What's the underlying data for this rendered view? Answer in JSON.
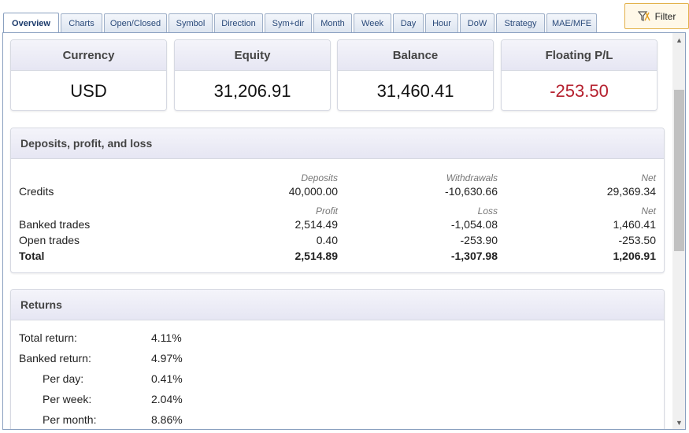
{
  "tabs": [
    {
      "label": "Overview",
      "active": true
    },
    {
      "label": "Charts"
    },
    {
      "label": "Open/Closed"
    },
    {
      "label": "Symbol"
    },
    {
      "label": "Direction"
    },
    {
      "label": "Sym+dir"
    },
    {
      "label": "Month"
    },
    {
      "label": "Week"
    },
    {
      "label": "Day"
    },
    {
      "label": "Hour"
    },
    {
      "label": "DoW"
    },
    {
      "label": "Strategy"
    },
    {
      "label": "MAE/MFE"
    }
  ],
  "filter": {
    "label": "Filter"
  },
  "summary": {
    "currency": {
      "label": "Currency",
      "value": "USD"
    },
    "equity": {
      "label": "Equity",
      "value": "31,206.91"
    },
    "balance": {
      "label": "Balance",
      "value": "31,460.41"
    },
    "floating": {
      "label": "Floating P/L",
      "value": "-253.50"
    }
  },
  "deposits": {
    "title": "Deposits, profit, and loss",
    "credits_header": {
      "c1": "Deposits",
      "c2": "Withdrawals",
      "c3": "Net"
    },
    "credits": {
      "label": "Credits",
      "c1": "40,000.00",
      "c2": "-10,630.66",
      "c3": "29,369.34"
    },
    "trades_header": {
      "c1": "Profit",
      "c2": "Loss",
      "c3": "Net"
    },
    "banked": {
      "label": "Banked trades",
      "c1": "2,514.49",
      "c2": "-1,054.08",
      "c3": "1,460.41"
    },
    "open": {
      "label": "Open trades",
      "c1": "0.40",
      "c2": "-253.90",
      "c3": "-253.50"
    },
    "total": {
      "label": "Total",
      "c1": "2,514.89",
      "c2": "-1,307.98",
      "c3": "1,206.91"
    }
  },
  "returns": {
    "title": "Returns",
    "rows": [
      {
        "label": "Total return:",
        "value": "4.11%"
      },
      {
        "label": "Banked return:",
        "value": "4.97%"
      },
      {
        "label": "Per day:",
        "value": "0.41%"
      },
      {
        "label": "Per week:",
        "value": "2.04%"
      },
      {
        "label": "Per month:",
        "value": "8.86%"
      }
    ]
  },
  "colors": {
    "negative": "#b5202e",
    "accent": "#e3b14a",
    "tab_border": "#8aa0c0"
  }
}
